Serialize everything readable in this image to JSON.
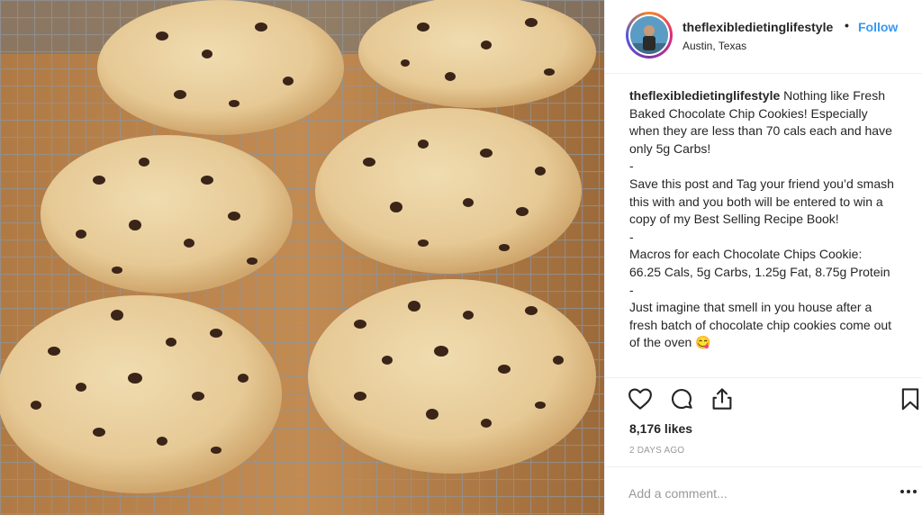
{
  "post": {
    "image_alt": "Chocolate chip cookies on a cooling rack",
    "header": {
      "username": "theflexibledietinglifestyle",
      "separator": "•",
      "follow_label": "Follow",
      "location": "Austin, Texas"
    },
    "caption": {
      "username": "theflexibledietinglifestyle",
      "paragraphs": [
        "Nothing like Fresh Baked Chocolate Chip Cookies! Especially when they are less than 70 cals each and have only 5g Carbs!",
        "-",
        "Save this post and Tag your friend you’d smash this with and you both will be entered to win a copy of my Best Selling Recipe Book!",
        "-",
        "Macros for each Chocolate Chips Cookie: 66.25 Cals, 5g Carbs, 1.25g Fat, 8.75g Protein",
        "-",
        "Just imagine that smell in you house after a fresh batch of chocolate chip cookies come out of the oven 😋"
      ]
    },
    "actions": {
      "icons": [
        "heart-icon",
        "comment-icon",
        "share-icon",
        "bookmark-icon"
      ]
    },
    "likes": "8,176 likes",
    "timestamp": "2 DAYS AGO",
    "comment": {
      "placeholder": "Add a comment...",
      "value": ""
    },
    "colors": {
      "link": "#3897f0",
      "text": "#262626",
      "muted": "#999999",
      "divider": "#efefef"
    }
  }
}
